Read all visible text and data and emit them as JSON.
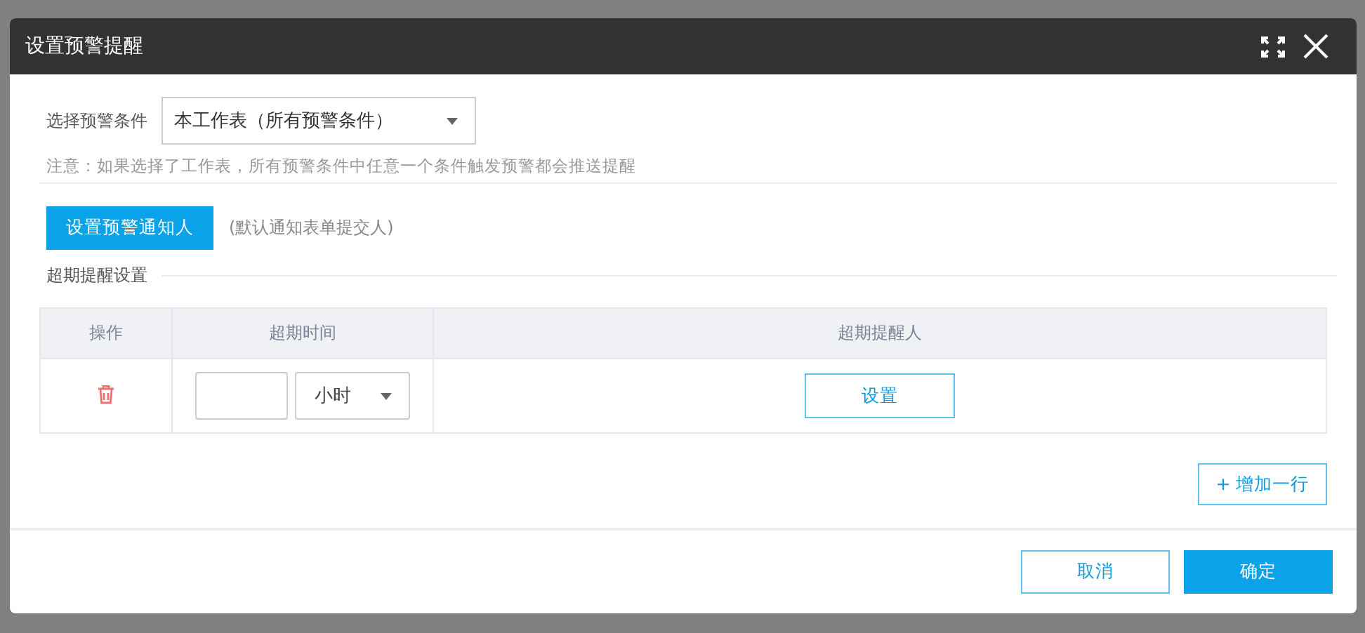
{
  "dialog": {
    "title": "设置预警提醒"
  },
  "condition": {
    "label": "选择预警条件",
    "value": "本工作表（所有预警条件）"
  },
  "note": "注意：如果选择了工作表，所有预警条件中任意一个条件触发预警都会推送提醒",
  "notify": {
    "button": "设置预警通知人",
    "hint": "(默认通知表单提交人)"
  },
  "section_title": "超期提醒设置",
  "table": {
    "columns": [
      "操作",
      "超期时间",
      "超期提醒人"
    ],
    "rows": [
      {
        "time_value": "",
        "unit": "小时",
        "recipient_button": "设置"
      }
    ]
  },
  "add_row_button": {
    "icon": "+",
    "label": "增加一行"
  },
  "buttons": [
    {
      "label": "取消",
      "kind": "secondary"
    },
    {
      "label": "确定",
      "kind": "primary"
    }
  ]
}
